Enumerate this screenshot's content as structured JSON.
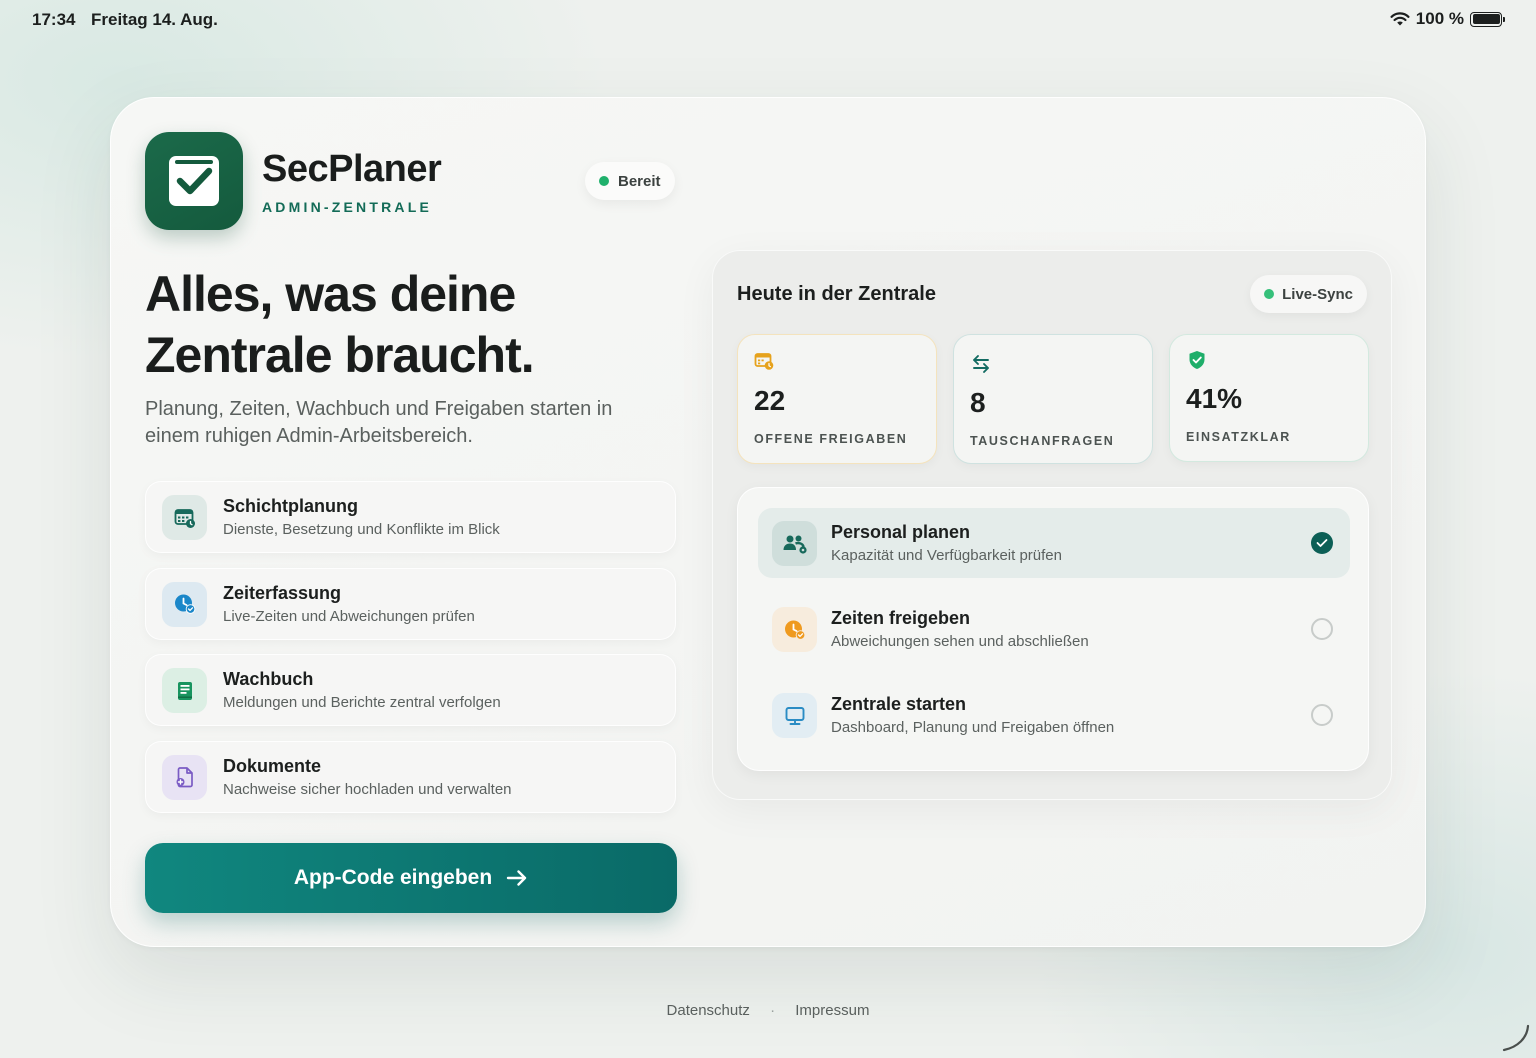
{
  "statusbar": {
    "time": "17:34",
    "date": "Freitag 14. Aug.",
    "battery": "100 %"
  },
  "brand": {
    "name": "SecPlaner",
    "subtitle": "ADMIN-ZENTRALE",
    "status": "Bereit",
    "logo_icon": "checkbox-icon"
  },
  "hero": {
    "headline_line1": "Alles, was deine",
    "headline_line2": "Zentrale braucht.",
    "subtitle": "Planung, Zeiten, Wachbuch und Freigaben starten in einem ruhigen Admin-Arbeitsbereich."
  },
  "features": [
    {
      "title": "Schichtplanung",
      "desc": "Dienste, Besetzung und Konflikte im Blick",
      "icon": "calendar-icon"
    },
    {
      "title": "Zeiterfassung",
      "desc": "Live-Zeiten und Abweichungen prüfen",
      "icon": "clock-icon"
    },
    {
      "title": "Wachbuch",
      "desc": "Meldungen und Berichte zentral verfolgen",
      "icon": "book-icon"
    },
    {
      "title": "Dokumente",
      "desc": "Nachweise sicher hochladen und verwalten",
      "icon": "document-icon"
    }
  ],
  "cta": {
    "label": "App-Code eingeben",
    "icon": "arrow-right-icon"
  },
  "panel": {
    "title": "Heute in der Zentrale",
    "sync": "Live-Sync",
    "stats": [
      {
        "value": "22",
        "label": "OFFENE FREIGABEN",
        "icon": "calendar-clock-icon"
      },
      {
        "value": "8",
        "label": "TAUSCHANFRAGEN",
        "icon": "swap-icon"
      },
      {
        "value": "41%",
        "label": "EINSATZKLAR",
        "icon": "shield-check-icon"
      }
    ],
    "tasks": [
      {
        "title": "Personal planen",
        "desc": "Kapazität und Verfügbarkeit prüfen",
        "icon": "people-icon",
        "done": true
      },
      {
        "title": "Zeiten freigeben",
        "desc": "Abweichungen sehen und abschließen",
        "icon": "clock-check-icon",
        "done": false
      },
      {
        "title": "Zentrale starten",
        "desc": "Dashboard, Planung und Freigaben öffnen",
        "icon": "monitor-icon",
        "done": false
      }
    ]
  },
  "footer": {
    "privacy": "Datenschutz",
    "separator": "·",
    "imprint": "Impressum"
  },
  "colors": {
    "brand": "#1b6a4a",
    "accent": "#0a6a67",
    "ready": "#1fb06b"
  }
}
